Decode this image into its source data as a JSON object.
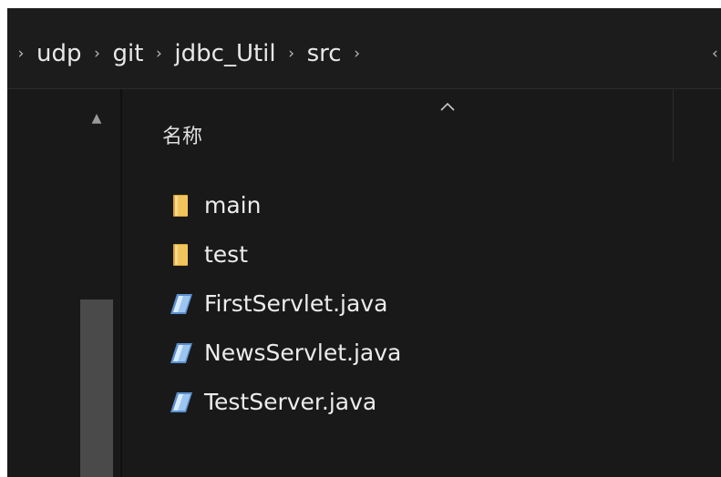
{
  "breadcrumb": {
    "items": [
      "udp",
      "git",
      "jdbc_Util",
      "src"
    ],
    "separator_icon": "chevron-right-icon"
  },
  "columns": {
    "name_header": "名称",
    "sort_icon": "sort-ascending-icon"
  },
  "files": [
    {
      "name": "main",
      "icon": "folder-icon"
    },
    {
      "name": "test",
      "icon": "folder-icon"
    },
    {
      "name": "FirstServlet.java",
      "icon": "java-file-icon"
    },
    {
      "name": "NewsServlet.java",
      "icon": "java-file-icon"
    },
    {
      "name": "TestServer.java",
      "icon": "java-file-icon"
    }
  ],
  "colors": {
    "background": "#191919",
    "text": "#ececec",
    "folder": "#f2c55c",
    "file_icon": "#7fb2e8"
  }
}
